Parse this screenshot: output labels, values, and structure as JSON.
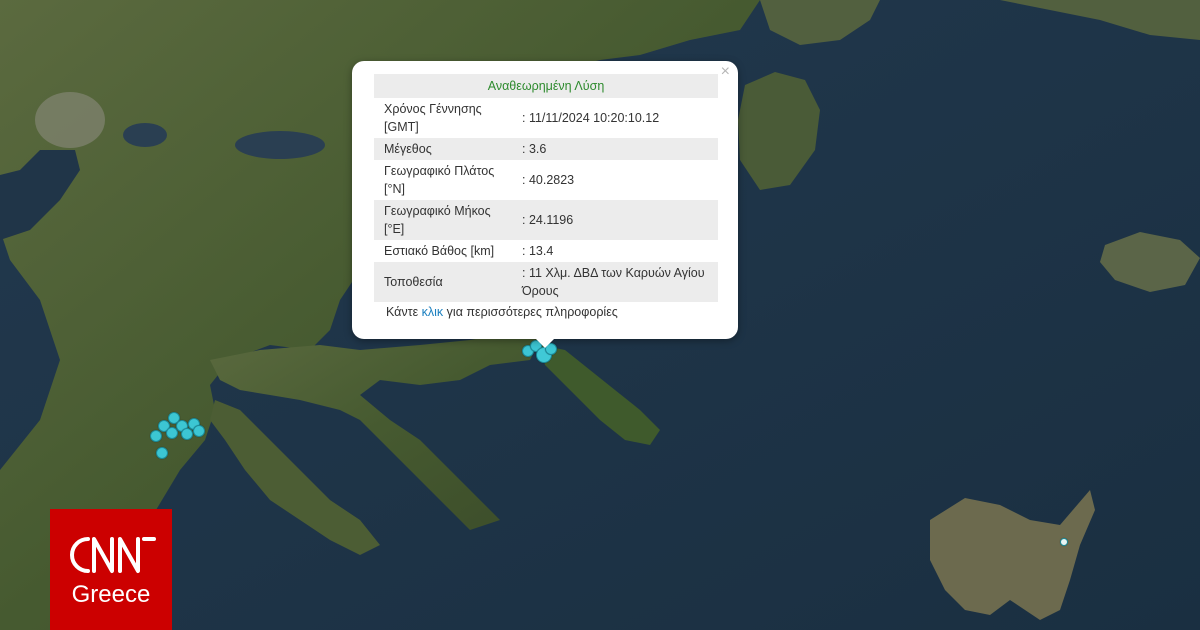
{
  "popup": {
    "title": "Αναθεωρημένη Λύση",
    "close_symbol": "×",
    "rows": [
      {
        "label": "Χρόνος Γέννησης [GMT]",
        "value": ": 11/11/2024 10:20:10.12"
      },
      {
        "label": "Μέγεθος",
        "value": ": 3.6"
      },
      {
        "label": "Γεωγραφικό Πλάτος [°N]",
        "value": ": 40.2823"
      },
      {
        "label": "Γεωγραφικό Μήκος [°E]",
        "value": ": 24.1196"
      },
      {
        "label": "Εστιακό Βάθος [km]",
        "value": ": 13.4"
      },
      {
        "label": "Τοποθεσία",
        "value": ": 11 Χλμ. ΔΒΔ των Καρυών Αγίου Όρους"
      }
    ],
    "footer_prefix": "Κάντε ",
    "footer_link": "κλικ",
    "footer_suffix": " για περισσότερες πληροφορίες"
  },
  "logo": {
    "brand": "CNN",
    "region": "Greece"
  },
  "colors": {
    "sea": "#1f3447",
    "land": "#4a5a34",
    "marker": "#3cc6d3",
    "logo_red": "#cc0000",
    "popup_title": "#2e8b2e",
    "link": "#1a7fbf"
  }
}
